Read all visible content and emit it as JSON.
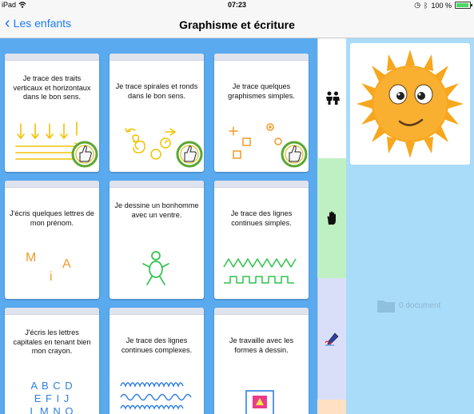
{
  "status": {
    "carrier": "iPad",
    "time": "07:23",
    "battery": "100 %",
    "battery_level": 1.0
  },
  "nav": {
    "back_label": "Les enfants",
    "title": "Graphisme et écriture"
  },
  "cards": [
    {
      "label": "Je trace des traits verticaux et horizontaux dans le bon sens.",
      "validated": true
    },
    {
      "label": "Je trace spirales et ronds dans le bon sens.",
      "validated": true
    },
    {
      "label": "Je trace quelques graphismes simples.",
      "validated": true
    },
    {
      "label": "J'écris quelques lettres de mon prénom.",
      "validated": false,
      "letters": [
        "M",
        "A",
        "i"
      ]
    },
    {
      "label": "Je dessine un bonhomme avec un ventre.",
      "validated": false
    },
    {
      "label": "Je trace des lignes continues simples.",
      "validated": false
    },
    {
      "label": "J'écris les lettres capitales en tenant bien mon crayon.",
      "validated": false,
      "letters": [
        "A B C D",
        "E F I J",
        "L M N O"
      ]
    },
    {
      "label": "Je trace des lignes continues complexes.",
      "validated": false
    },
    {
      "label": "Je travaille avec les formes à dessin.",
      "validated": false
    }
  ],
  "sidebar": {
    "icons": [
      "children-icon",
      "hand-icon",
      "writing-icon"
    ],
    "colors": [
      "#ffffff",
      "#bff0c3",
      "#dadff9",
      "#ffe0c2"
    ]
  },
  "right_panel": {
    "document_count": "0 document"
  },
  "colors": {
    "accent": "#1a7cf5",
    "main_bg": "#5aaaf0",
    "panel_bg": "#a9dcf8",
    "drawing_yellow": "#f2c200",
    "drawing_orange": "#f39a2a",
    "drawing_green": "#2ec24a",
    "drawing_blue": "#2f7fe0"
  }
}
